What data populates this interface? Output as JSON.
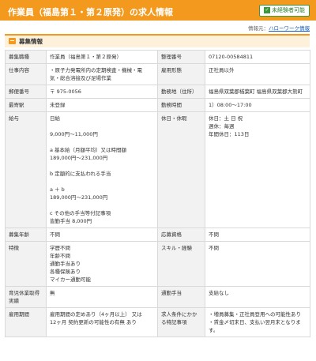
{
  "title": "作業員（福島第１・第２原発）の求人情報",
  "badge": "未経験者可能",
  "source_label": "情報元：",
  "source_link": "ハローワーク情報",
  "section_label": "募集情報",
  "rows": [
    {
      "l": "募集職種",
      "v": [
        "作業員（福島第１・第２原発）"
      ],
      "r": "整理番号",
      "rv": [
        "07120-00584811"
      ]
    },
    {
      "l": "仕事内容",
      "v": [
        "・原子力発電所内の定期検査・機械・電",
        "気・総合溶接及び足場作業"
      ],
      "r": "雇用形態",
      "rv": [
        "正社員以外"
      ]
    },
    {
      "l": "郵便番号",
      "v": [
        "〒 975-0056"
      ],
      "r": "勤務地（住所）",
      "rv": [
        "福島県双葉郡楢葉町 福島県双葉郡大熊町"
      ]
    },
    {
      "l": "最寄駅",
      "v": [
        "未登録"
      ],
      "r": "勤務時間",
      "rv": [
        "1）08:00〜17:00"
      ]
    },
    {
      "l": "給与",
      "v": [
        "日給",
        "",
        "9,000円〜11,000円",
        "",
        "a 基本給（月額平均）又は時間額",
        "189,000円〜231,000円",
        "",
        "b 定額的に支払われる手当",
        "",
        "a ＋ b",
        "189,000円〜231,000円",
        "",
        "c その他の手当等付記事項",
        "皆勤手当 8,000円"
      ],
      "r": "休日・休暇",
      "rv": [
        "休日：土 日 祝",
        "週休：毎週",
        "年間休日：113日"
      ]
    },
    {
      "l": "募集年齢",
      "v": [
        "不問"
      ],
      "r": "応募資格",
      "rv": [
        "不問"
      ]
    },
    {
      "l": "特徴",
      "v": [
        "学歴不問",
        "年齢不問",
        "通勤手当あり",
        "各種保険あり",
        "マイカー通勤可能"
      ],
      "r": "スキル・経験",
      "rv": [
        "不問"
      ]
    },
    {
      "l": "育児休業取得実績",
      "v": [
        "無"
      ],
      "r": "通勤手当",
      "rv": [
        "支給なし"
      ]
    },
    {
      "l": "雇用期間",
      "v": [
        "雇用期間の定めあり（4ヶ月以上） 又は",
        "12ヶ月 契約更新の可能性の有無 あり"
      ],
      "r": "求人条件にかかる特記事項",
      "rv": [
        "・増員募集・正社員登用への可能性あり",
        "・賃金〆切末日、支払い翌月末となります。"
      ]
    }
  ]
}
